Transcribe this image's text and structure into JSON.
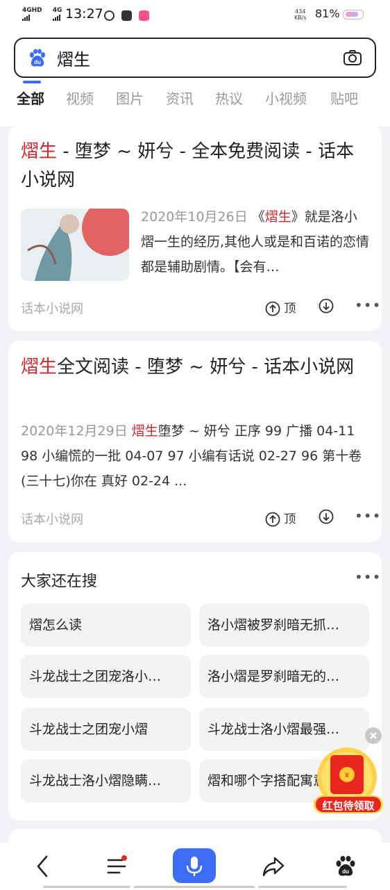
{
  "status_bar": {
    "net1": "4GHD",
    "net2": "4G",
    "time": "13:27",
    "speed_value": "434",
    "speed_unit": "KB/s",
    "battery": "81%"
  },
  "search": {
    "query": "熠生"
  },
  "tabs": [
    "全部",
    "视频",
    "图片",
    "资讯",
    "热议",
    "小视频",
    "贴吧"
  ],
  "results": [
    {
      "title_hl": "熠生",
      "title_rest": " - 堕梦 ~ 妍兮 - 全本免费阅读 - 话本小说网",
      "date": "2020年10月26日",
      "snippet_pre": " 《",
      "snippet_hl": "熠生",
      "snippet_post": "》就是洛小熠一生的经历,其他人或是和百诺的恋情都是辅助剧情。【会有…",
      "source": "话本小说网",
      "top_label": "顶"
    },
    {
      "title_hl": "熠生",
      "title_rest": "全文阅读 - 堕梦 ~ 妍兮 - 话本小说网",
      "date": "2020年12月29日",
      "snippet_hl": "熠生",
      "snippet_post": "堕梦 ~ 妍兮 正序 99 广播 04-11 98 小编慌的一批 04-07 97 小编有话说 02-27 96 第十卷(三十七)你在 真好 02-24 ...",
      "source": "话本小说网",
      "top_label": "顶"
    }
  ],
  "also_search": {
    "title": "大家还在搜",
    "items": [
      "熠怎么读",
      "洛小熠被罗刹暗无抓…",
      "斗龙战士之团宠洛小…",
      "洛小熠是罗刹暗无的…",
      "斗龙战士之团宠小熠",
      "斗龙战士洛小熠最强…",
      "斗龙战士洛小熠隐瞒…",
      "熠和哪个字搭配寓意…"
    ]
  },
  "red_packet": {
    "label": "红包待领取"
  },
  "colors": {
    "accent": "#3b6cf6",
    "highlight": "#d0252c",
    "red_packet": "#e02020"
  },
  "bottom_nav": [
    "back-icon",
    "menu-icon",
    "microphone-icon",
    "share-icon",
    "baidu-paw-icon"
  ]
}
